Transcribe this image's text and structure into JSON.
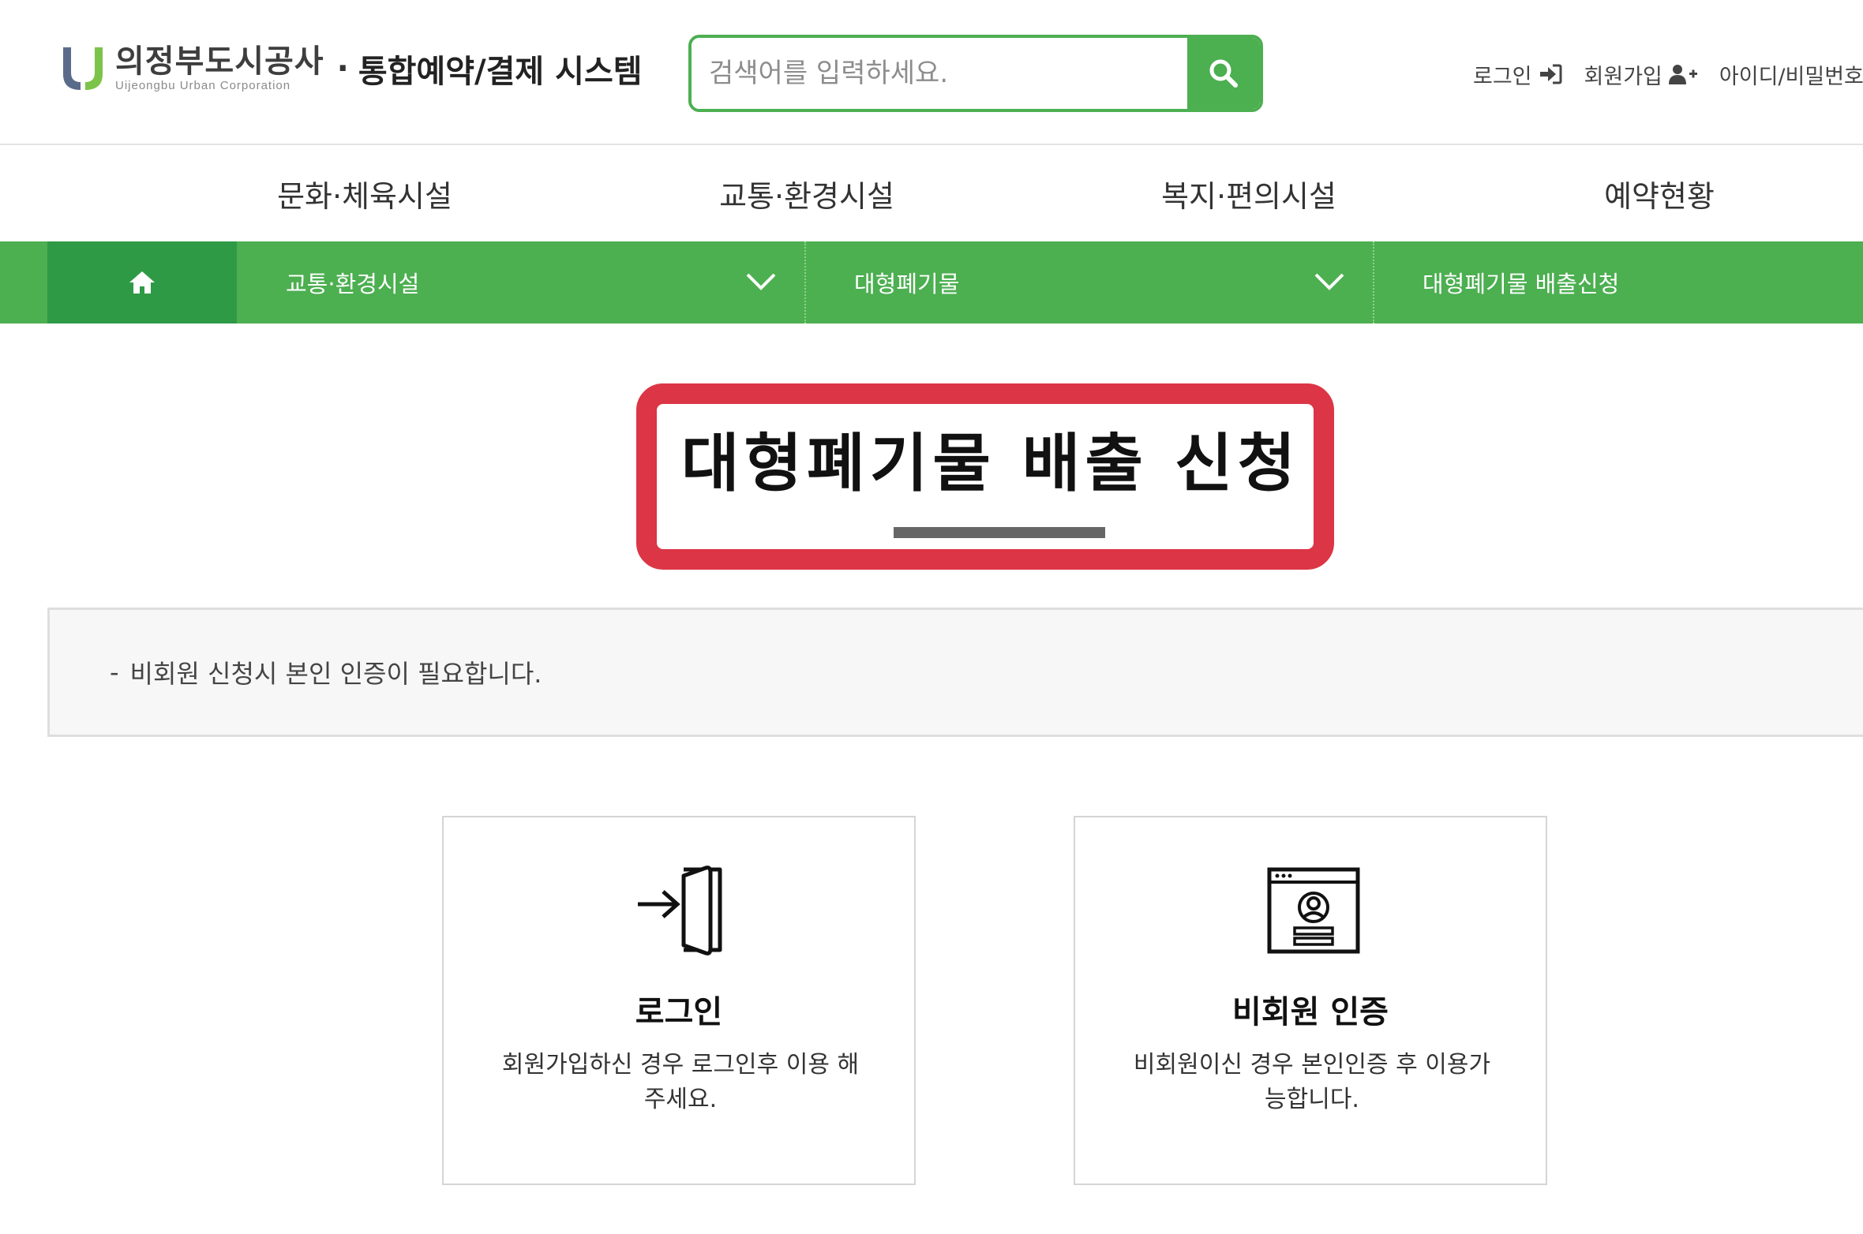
{
  "header": {
    "logo_kor": "의정부도시공사",
    "logo_eng": "Uijeongbu Urban Corporation",
    "logo_dot": "·",
    "system_title": "통합예약/결제 시스템",
    "search": {
      "placeholder": "검색어를 입력하세요.",
      "icon": "search-icon"
    },
    "util_links": [
      {
        "label": "로그인",
        "icon": "sign-in-icon"
      },
      {
        "label": "회원가입",
        "icon": "user-plus-icon"
      },
      {
        "label": "아이디/비밀번호",
        "icon": ""
      }
    ]
  },
  "main_nav": {
    "items": [
      {
        "label": "문화·체육시설"
      },
      {
        "label": "교통·환경시설"
      },
      {
        "label": "복지·편의시설"
      },
      {
        "label": "예약현황"
      }
    ]
  },
  "sub_nav": {
    "home_icon": "home-icon",
    "crumbs": [
      {
        "label": "교통·환경시설",
        "has_dropdown": true
      },
      {
        "label": "대형폐기물",
        "has_dropdown": true
      },
      {
        "label": "대형폐기물 배출신청",
        "has_dropdown": false
      }
    ]
  },
  "page": {
    "title": "대형폐기물 배출 신청"
  },
  "notice": {
    "dash": "-",
    "text": "비회원 신청시 본인 인증이 필요합니다."
  },
  "cards": [
    {
      "icon": "login-door-icon",
      "title": "로그인",
      "desc": "회원가입하신 경우 로그인후 이용 해 주세요."
    },
    {
      "icon": "nonmember-id-icon",
      "title": "비회원 인증",
      "desc": "비회원이신 경우 본인인증 후 이용가 능합니다."
    }
  ],
  "colors": {
    "brand_green": "#4caf50",
    "brand_green_dark": "#2f9a46",
    "highlight_red": "#dc3545"
  }
}
